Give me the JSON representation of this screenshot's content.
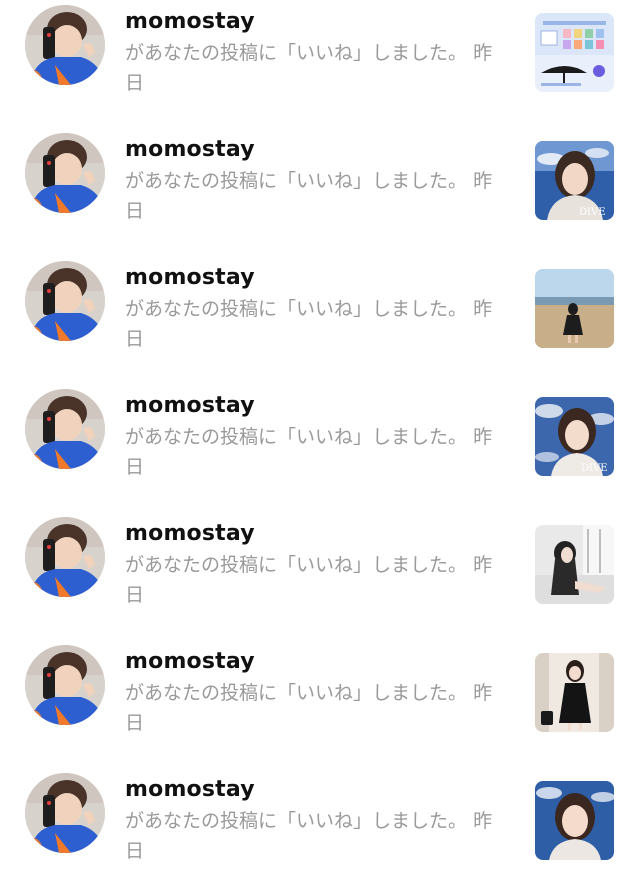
{
  "notifications": [
    {
      "username": "momostay",
      "message": "があなたの投稿に「いいね」しました。",
      "time": "昨日",
      "thumb_icon": "product-collage-thumbnail"
    },
    {
      "username": "momostay",
      "message": "があなたの投稿に「いいね」しました。",
      "time": "昨日",
      "thumb_icon": "portrait-photo-thumbnail"
    },
    {
      "username": "momostay",
      "message": "があなたの投稿に「いいね」しました。",
      "time": "昨日",
      "thumb_icon": "beach-photo-thumbnail"
    },
    {
      "username": "momostay",
      "message": "があなたの投稿に「いいね」しました。",
      "time": "昨日",
      "thumb_icon": "portrait-photo-thumbnail"
    },
    {
      "username": "momostay",
      "message": "があなたの投稿に「いいね」しました。",
      "time": "昨日",
      "thumb_icon": "window-photo-thumbnail"
    },
    {
      "username": "momostay",
      "message": "があなたの投稿に「いいね」しました。",
      "time": "昨日",
      "thumb_icon": "black-dress-photo-thumbnail"
    },
    {
      "username": "momostay",
      "message": "があなたの投稿に「いいね」しました。",
      "time": "昨日",
      "thumb_icon": "portrait-photo-thumbnail"
    }
  ],
  "colors": {
    "username": "#111111",
    "message": "#9a9a9a",
    "avatar_shirt": "#2d5fd0",
    "avatar_accent": "#f07a2a"
  }
}
